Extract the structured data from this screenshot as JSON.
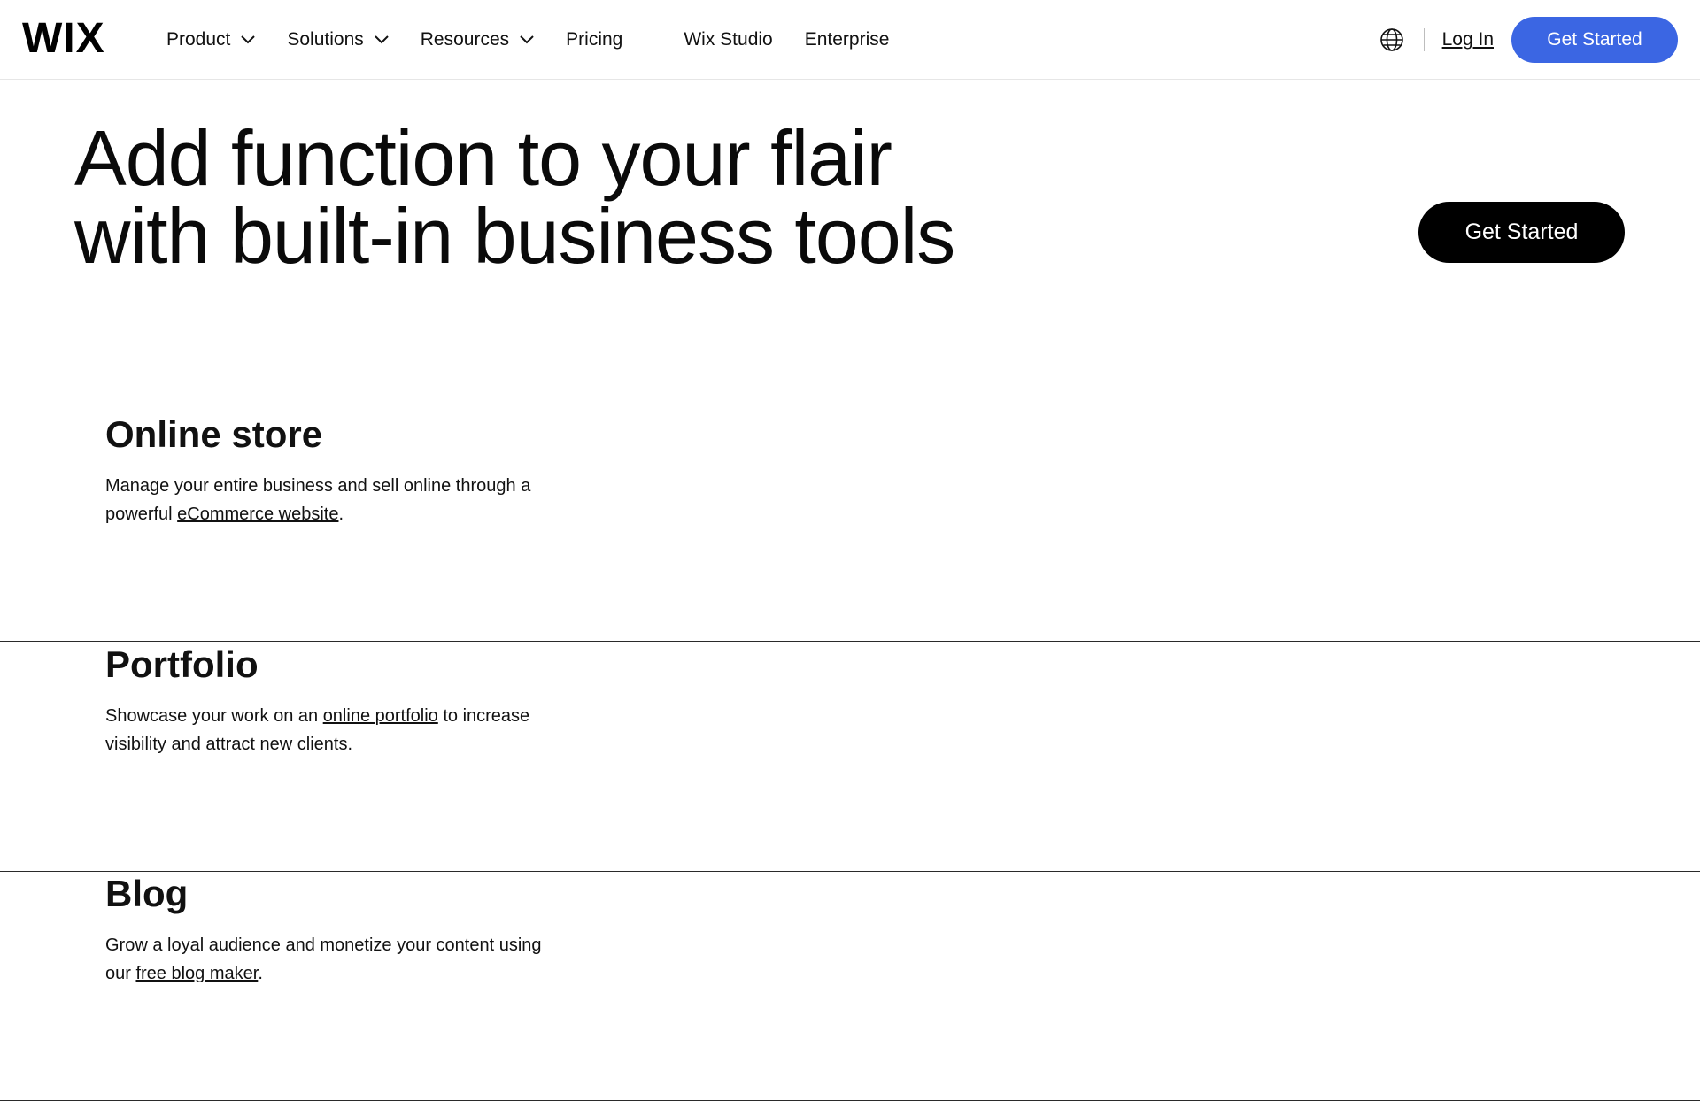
{
  "header": {
    "logo": "WIX",
    "nav": [
      {
        "label": "Product",
        "has_dropdown": true
      },
      {
        "label": "Solutions",
        "has_dropdown": true
      },
      {
        "label": "Resources",
        "has_dropdown": true
      },
      {
        "label": "Pricing",
        "has_dropdown": false
      }
    ],
    "nav_secondary": [
      {
        "label": "Wix Studio"
      },
      {
        "label": "Enterprise"
      }
    ],
    "language_icon": "globe-icon",
    "login_label": "Log In",
    "cta_label": "Get Started",
    "cta_color": "#3b66e3"
  },
  "hero": {
    "title_line1": "Add function to your flair",
    "title_line2": "with built-in business tools",
    "cta_label": "Get Started"
  },
  "features": [
    {
      "title": "Online store",
      "desc_before": "Manage your entire business and sell online through a powerful ",
      "link": "eCommerce website",
      "desc_after": "."
    },
    {
      "title": "Portfolio",
      "desc_before": "Showcase your work on an ",
      "link": "online portfolio",
      "desc_after": " to increase visibility and attract new clients."
    },
    {
      "title": "Blog",
      "desc_before": "Grow a loyal audience and monetize your content using our ",
      "link": "free blog maker",
      "desc_after": "."
    }
  ]
}
